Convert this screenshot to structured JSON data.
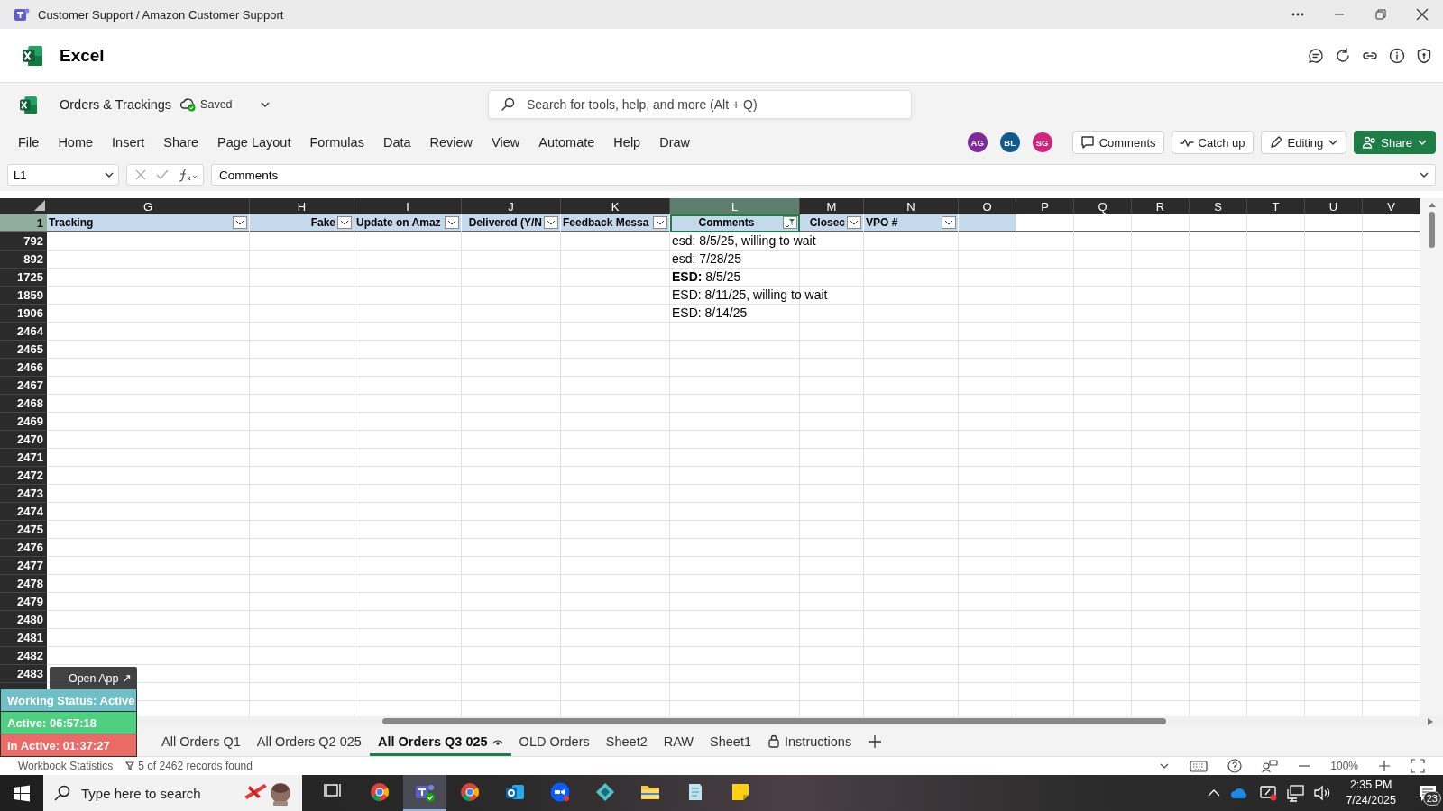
{
  "window": {
    "title": "Customer Support / Amazon Customer Support"
  },
  "app": {
    "name": "Excel"
  },
  "toolbar": {
    "file_name": "Orders & Trackings",
    "save_status": "Saved",
    "search": {
      "placeholder": "Search for tools, help, and more (Alt + Q)"
    }
  },
  "menu": [
    "File",
    "Home",
    "Insert",
    "Share",
    "Page Layout",
    "Formulas",
    "Data",
    "Review",
    "View",
    "Automate",
    "Help",
    "Draw"
  ],
  "collaborators": [
    {
      "initials": "AG",
      "color": "#7e2a9c"
    },
    {
      "initials": "BL",
      "color": "#0f5a8f"
    },
    {
      "initials": "SG",
      "color": "#d4237f"
    }
  ],
  "actions": [
    {
      "kind": "comments",
      "label": "Comments"
    },
    {
      "kind": "catchup",
      "label": "Catch up"
    },
    {
      "kind": "editing",
      "label": "Editing"
    },
    {
      "kind": "share",
      "label": "Share"
    }
  ],
  "formula_bar": {
    "name_box": "L1",
    "formula": "Comments"
  },
  "table": {
    "columns": [
      {
        "letter": "G",
        "header": "Tracking",
        "selected": false,
        "filtered": false
      },
      {
        "letter": "H",
        "header": "Fake",
        "selected": false,
        "filtered": false
      },
      {
        "letter": "I",
        "header": "Update on Amaz",
        "selected": false,
        "filtered": false
      },
      {
        "letter": "J",
        "header": "Delivered (Y/N",
        "selected": false,
        "filtered": false
      },
      {
        "letter": "K",
        "header": "Feedback Messa",
        "selected": false,
        "filtered": false
      },
      {
        "letter": "L",
        "header": "Comments",
        "selected": true,
        "filtered": true
      },
      {
        "letter": "M",
        "header": "Closec",
        "selected": false,
        "filtered": false
      },
      {
        "letter": "N",
        "header": "VPO #",
        "selected": false,
        "filtered": false
      },
      {
        "letter": "O",
        "selected": false
      },
      {
        "letter": "P",
        "selected": false
      },
      {
        "letter": "Q",
        "selected": false
      },
      {
        "letter": "R",
        "selected": false
      },
      {
        "letter": "S",
        "selected": false
      },
      {
        "letter": "T",
        "selected": false
      },
      {
        "letter": "U",
        "selected": false
      },
      {
        "letter": "V",
        "selected": false
      }
    ],
    "header_row": "1",
    "rows": [
      {
        "number": "792",
        "comment": "esd: 8/5/25, willing to wait"
      },
      {
        "number": "892",
        "comment": "esd: 7/28/25"
      },
      {
        "number": "1725",
        "comment": "**ESD:**  8/5/25"
      },
      {
        "number": "1859",
        "comment": "ESD: 8/11/25, willing to wait"
      },
      {
        "number": "1906",
        "comment": "ESD: 8/14/25"
      },
      {
        "number": "2464"
      },
      {
        "number": "2465"
      },
      {
        "number": "2466"
      },
      {
        "number": "2467"
      },
      {
        "number": "2468"
      },
      {
        "number": "2469"
      },
      {
        "number": "2470"
      },
      {
        "number": "2471"
      },
      {
        "number": "2472"
      },
      {
        "number": "2473"
      },
      {
        "number": "2474"
      },
      {
        "number": "2475"
      },
      {
        "number": "2476"
      },
      {
        "number": "2477"
      },
      {
        "number": "2478"
      },
      {
        "number": "2479"
      },
      {
        "number": "2480"
      },
      {
        "number": "2481"
      },
      {
        "number": "2482"
      },
      {
        "number": "2483"
      }
    ]
  },
  "sheet_tabs": [
    {
      "label": "All Orders Q1",
      "selected": false,
      "kind": "plain"
    },
    {
      "label": "All Orders Q2 025",
      "selected": false,
      "kind": "plain"
    },
    {
      "label": "All Orders Q3 025",
      "selected": true,
      "kind": "watched"
    },
    {
      "label": "OLD Orders",
      "selected": false,
      "kind": "plain"
    },
    {
      "label": "Sheet2",
      "selected": false,
      "kind": "plain"
    },
    {
      "label": "RAW",
      "selected": false,
      "kind": "plain"
    },
    {
      "label": "Sheet1",
      "selected": false,
      "kind": "plain"
    },
    {
      "label": "Instructions",
      "selected": false,
      "kind": "locked"
    }
  ],
  "status_bar": {
    "left": "Workbook Statistics",
    "filter_info": "5 of 2462 records found",
    "zoom": "100%"
  },
  "time_tracker": {
    "open_app": "Open App ↗",
    "status": "Working Status: Active",
    "active": "Active: 06:57:18",
    "inactive": "In Active: 01:37:27"
  },
  "taskbar": {
    "search": {
      "placeholder": "Type here to search"
    },
    "apps": [
      {
        "kind": "taskview",
        "selected": false
      },
      {
        "kind": "browser",
        "selected": false
      },
      {
        "kind": "chat",
        "selected": true
      },
      {
        "kind": "browser",
        "selected": false
      },
      {
        "kind": "mail",
        "selected": false
      },
      {
        "kind": "video",
        "selected": false
      },
      {
        "kind": "diamond",
        "selected": false
      },
      {
        "kind": "folder",
        "selected": false
      },
      {
        "kind": "notepad",
        "selected": false
      },
      {
        "kind": "note",
        "selected": false
      }
    ],
    "time": "2:35 PM",
    "date": "7/24/2025",
    "notifications": "23"
  }
}
